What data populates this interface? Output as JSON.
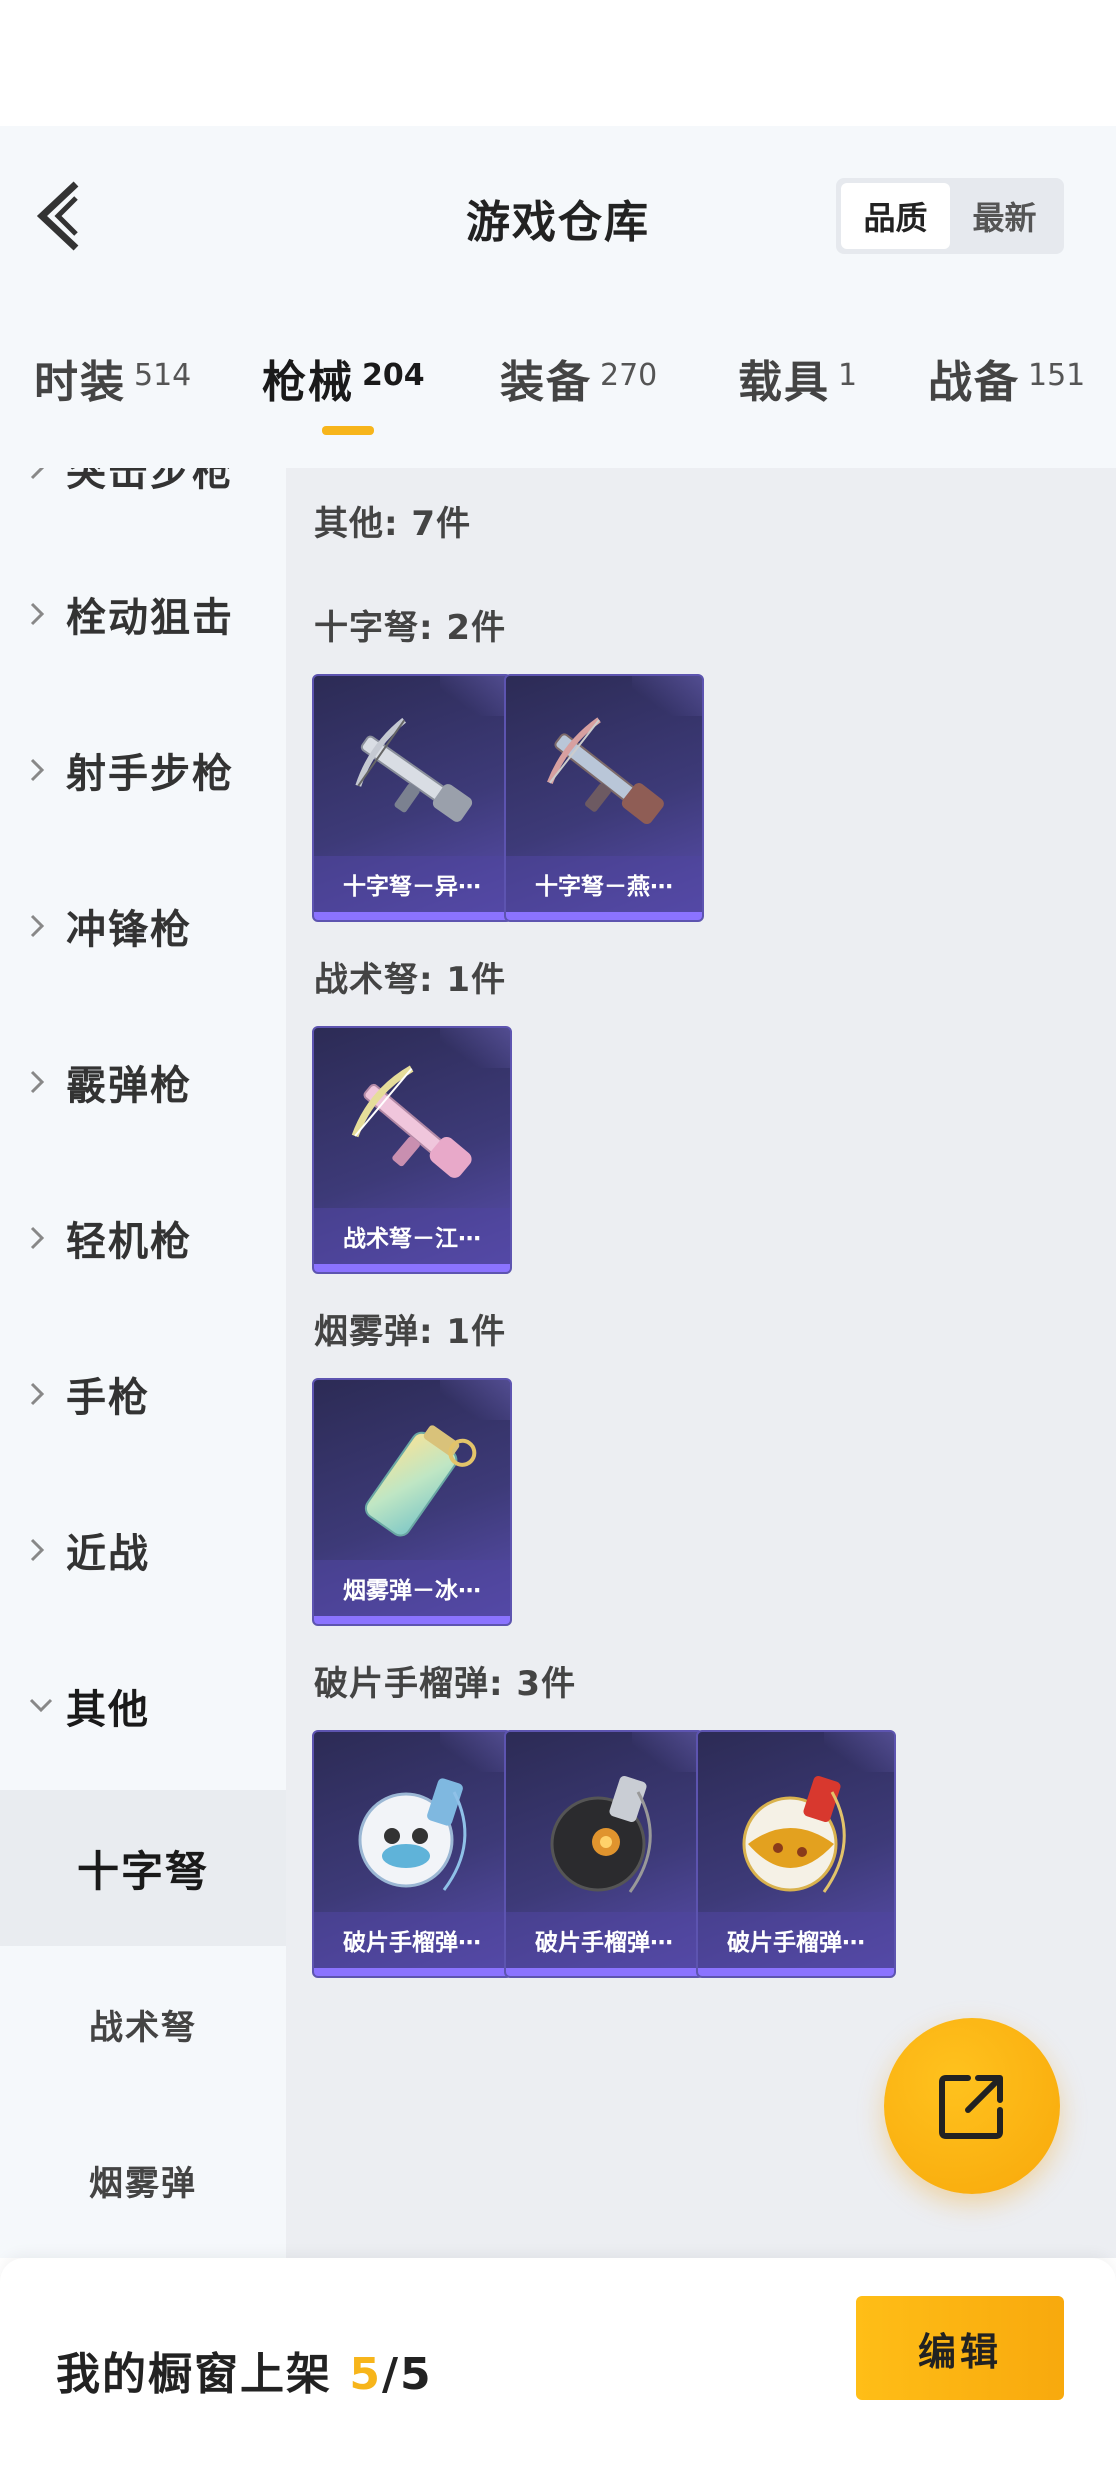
{
  "header": {
    "title": "游戏仓库",
    "sort_options": [
      "品质",
      "最新"
    ],
    "sort_active": "品质"
  },
  "tabs": [
    {
      "label": "时装",
      "count": "514"
    },
    {
      "label": "枪械",
      "count": "204"
    },
    {
      "label": "装备",
      "count": "270"
    },
    {
      "label": "载具",
      "count": "1"
    },
    {
      "label": "战备",
      "count": "151"
    }
  ],
  "active_tab": "枪械",
  "sidebar": {
    "partial_item": "突击步枪",
    "items": [
      "栓动狙击",
      "射手步枪",
      "冲锋枪",
      "霰弹枪",
      "轻机枪",
      "手枪",
      "近战"
    ],
    "expanded_item": "其他",
    "sub_items": [
      "十字弩",
      "战术弩",
      "烟雾弹"
    ],
    "active_sub_item": "十字弩"
  },
  "main": {
    "summary": "其他: 7件",
    "sections": [
      {
        "label": "十字弩: 2件",
        "items": [
          "十字弩－异⋯",
          "十字弩－燕⋯"
        ]
      },
      {
        "label": "战术弩: 1件",
        "items": [
          "战术弩－江⋯"
        ]
      },
      {
        "label": "烟雾弹: 1件",
        "items": [
          "烟雾弹－冰⋯"
        ]
      },
      {
        "label": "破片手榴弹: 3件",
        "items": [
          "破片手榴弹⋯",
          "破片手榴弹⋯",
          "破片手榴弹⋯"
        ]
      }
    ]
  },
  "bottom": {
    "showcase_label": "我的橱窗上架",
    "showcase_current": "5",
    "showcase_total": "/5",
    "edit_label": "编辑"
  },
  "icons": [
    "back-icon",
    "chevron-right-icon",
    "chevron-down-icon",
    "share-external-icon"
  ],
  "colors": {
    "accent": "#f7b51b",
    "card_purple": "#3d3a78",
    "card_bar": "#8b73ff"
  }
}
